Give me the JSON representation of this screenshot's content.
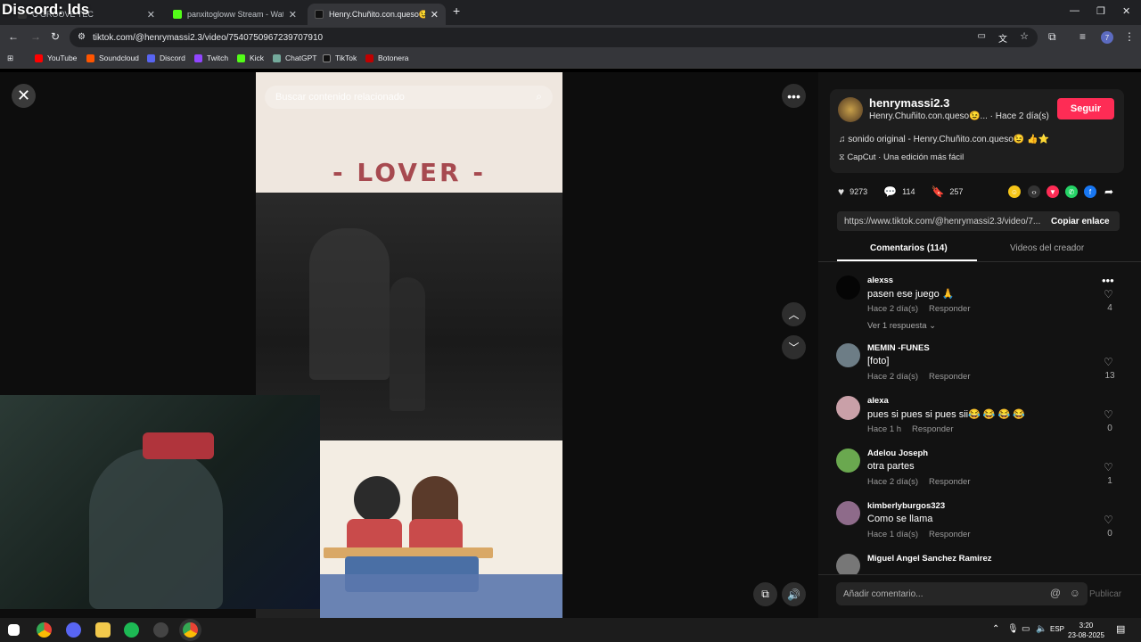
{
  "overlay": {
    "discord_label": "Discord: lds"
  },
  "tabs": [
    {
      "title": "C GROOVE TEC",
      "active": false
    },
    {
      "title": "panxitogloww Stream - Watch",
      "active": false
    },
    {
      "title": "Henry.Chuñito.con.queso😉",
      "active": true
    }
  ],
  "browser": {
    "url": "tiktok.com/@henrymassi2.3/video/7540750967239707910",
    "bookmarks": [
      "YouTube",
      "Soundcloud",
      "Discord",
      "Twitch",
      "Kick",
      "ChatGPT",
      "TikTok",
      "Botonera"
    ],
    "bookmark_colors": [
      "#ff0000",
      "#ff5500",
      "#5865f2",
      "#9146ff",
      "#53fc18",
      "#74aa9c",
      "#111111",
      "#c00000"
    ]
  },
  "video": {
    "search_placeholder": "Buscar contenido relacionado",
    "overlay_text": "- LOVER -"
  },
  "creator": {
    "username": "henrymassi2.3",
    "nickname": "Henry.Chuñito.con.queso😉...",
    "posted": "· Hace 2 día(s)",
    "follow_label": "Seguir",
    "sound": "sonido original - Henry.Chuñito.con.queso😉 👍⭐",
    "capcut": "CapCut · Una edición más fácil"
  },
  "stats": {
    "likes": "9273",
    "comments": "114",
    "saves": "257"
  },
  "link": {
    "url": "https://www.tiktok.com/@henrymassi2.3/video/7...",
    "copy_label": "Copiar enlace"
  },
  "panel_tabs": {
    "comments": "Comentarios (114)",
    "creator_videos": "Videos del creador"
  },
  "comments": [
    {
      "user": "alexss",
      "text": "pasen ese juego 🙏",
      "time": "Hace 2 día(s)",
      "reply": "Responder",
      "likes": "4",
      "avatar_color": "#050505"
    },
    {
      "user": "MEMIN -FUNES",
      "text": "[foto]",
      "time": "Hace 2 día(s)",
      "reply": "Responder",
      "likes": "13",
      "avatar_color": "#6d7d86"
    },
    {
      "user": "alexa",
      "text": "pues si pues si pues sii😂 😂 😂 😂",
      "time": "Hace 1 h",
      "reply": "Responder",
      "likes": "0",
      "avatar_color": "#c9a0a8"
    },
    {
      "user": "Adelou Joseph",
      "text": "otra partes",
      "time": "Hace 2 día(s)",
      "reply": "Responder",
      "likes": "1",
      "avatar_color": "#6aa84f"
    },
    {
      "user": "kimberlyburgos323",
      "text": "Como se llama",
      "time": "Hace 1 día(s)",
      "reply": "Responder",
      "likes": "0",
      "avatar_color": "#8e6b8a"
    },
    {
      "user": "Miguel Angel Sanchez Ramirez",
      "text": "",
      "time": "",
      "reply": "",
      "likes": "",
      "avatar_color": "#777777"
    }
  ],
  "view_replies": "Ver 1 respuesta ⌄",
  "comment_input": {
    "placeholder": "Añadir comentario...",
    "publish_label": "Publicar"
  },
  "taskbar": {
    "lang": "ESP",
    "time": "3:20",
    "date": "23-08-2025"
  }
}
